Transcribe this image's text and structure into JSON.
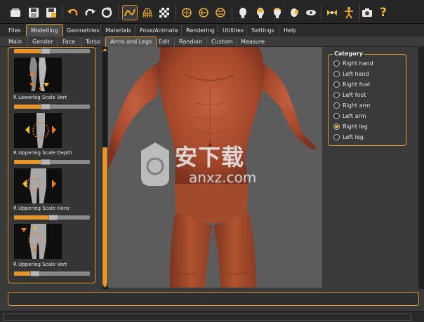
{
  "toolbar": {
    "buttons": [
      {
        "icon": "new-file-icon"
      },
      {
        "icon": "save-icon"
      },
      {
        "icon": "export-icon"
      },
      {
        "icon": "undo-icon"
      },
      {
        "icon": "redo-icon"
      },
      {
        "icon": "reset-icon"
      },
      {
        "icon": "smooth-icon"
      },
      {
        "icon": "wireframe-icon"
      },
      {
        "icon": "background-icon"
      },
      {
        "icon": "front-view-icon"
      },
      {
        "icon": "back-view-icon"
      },
      {
        "icon": "side-view-icon"
      },
      {
        "icon": "face-front-icon"
      },
      {
        "icon": "face-back-icon"
      },
      {
        "icon": "face-left-icon"
      },
      {
        "icon": "face-right-icon"
      },
      {
        "icon": "face-top-icon"
      },
      {
        "icon": "global-camera-icon"
      },
      {
        "icon": "skeleton-icon"
      },
      {
        "icon": "screenshot-icon"
      },
      {
        "icon": "help-icon"
      }
    ],
    "help_glyph": "?"
  },
  "main_tabs": [
    "Files",
    "Modelling",
    "Geometries",
    "Materials",
    "Pose/Animate",
    "Rendering",
    "Utilities",
    "Settings",
    "Help"
  ],
  "main_tab_active": "Modelling",
  "sub_tabs": [
    "Main",
    "Gender",
    "Face",
    "Torso",
    "Arms and Legs",
    "Edit",
    "Random",
    "Custom",
    "Measure"
  ],
  "sub_tab_active": "Arms and Legs",
  "modifiers": [
    {
      "label": "",
      "value": 0.42
    },
    {
      "label": "R Lowerleg Scale Vert",
      "value": 0.42
    },
    {
      "label": "R Upperleg Scale Depth",
      "value": 0.42
    },
    {
      "label": "R Upperleg Scale Horiz",
      "value": 0.52
    },
    {
      "label": "R Upperleg Scale Vert",
      "value": 0.28
    }
  ],
  "category": {
    "title": "Category",
    "options": [
      "Right hand",
      "Left hand",
      "Right foot",
      "Left foot",
      "Right arm",
      "Left arm",
      "Right leg",
      "Left leg"
    ],
    "selected": "Right leg"
  },
  "watermark": {
    "text": "安下载",
    "domain": "anxz.com"
  },
  "colors": {
    "accent": "#e09a2a",
    "skin": "#a84a2a",
    "viewport_bg": "#5c5c5c"
  }
}
